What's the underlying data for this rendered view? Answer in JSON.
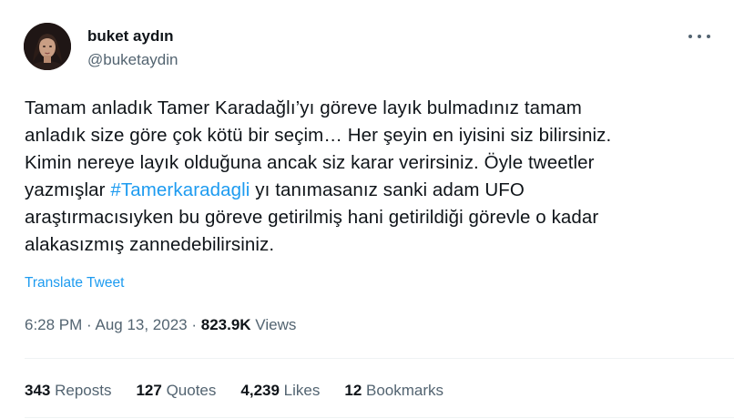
{
  "author": {
    "display_name": "buket aydın",
    "handle": "@buketaydin"
  },
  "tweet": {
    "lines": [
      "Tamam anladık Tamer Karadağlı’yı göreve layık bulmadınız tamam",
      "anladık size göre çok kötü bir seçim… Her şeyin en iyisini siz bilirsiniz.",
      "Kimin nereye layık olduğuna ancak siz karar verirsiniz. Öyle tweetler",
      "araştırmacısıyken bu göreve getirilmiş hani getirildiği görevle o kadar",
      "alakasızmış zannedebilirsiniz."
    ],
    "line4_before": "yazmışlar ",
    "hashtag": "#Tamerkaradagli",
    "line4_after": " yı tanımasanız sanki adam UFO",
    "translate_label": "Translate Tweet"
  },
  "meta": {
    "time": "6:28 PM",
    "separator": " · ",
    "date": "Aug 13, 2023",
    "separator2": " · ",
    "views_count": "823.9K",
    "views_label": " Views"
  },
  "stats": {
    "reposts_count": "343",
    "reposts_label": " Reposts",
    "quotes_count": "127",
    "quotes_label": " Quotes",
    "likes_count": "4,239",
    "likes_label": " Likes",
    "bookmarks_count": "12",
    "bookmarks_label": " Bookmarks"
  },
  "colors": {
    "link": "#1d9bf0",
    "secondary_text": "#536471",
    "primary_text": "#0f1419"
  },
  "icons": {
    "more": "more-icon"
  }
}
